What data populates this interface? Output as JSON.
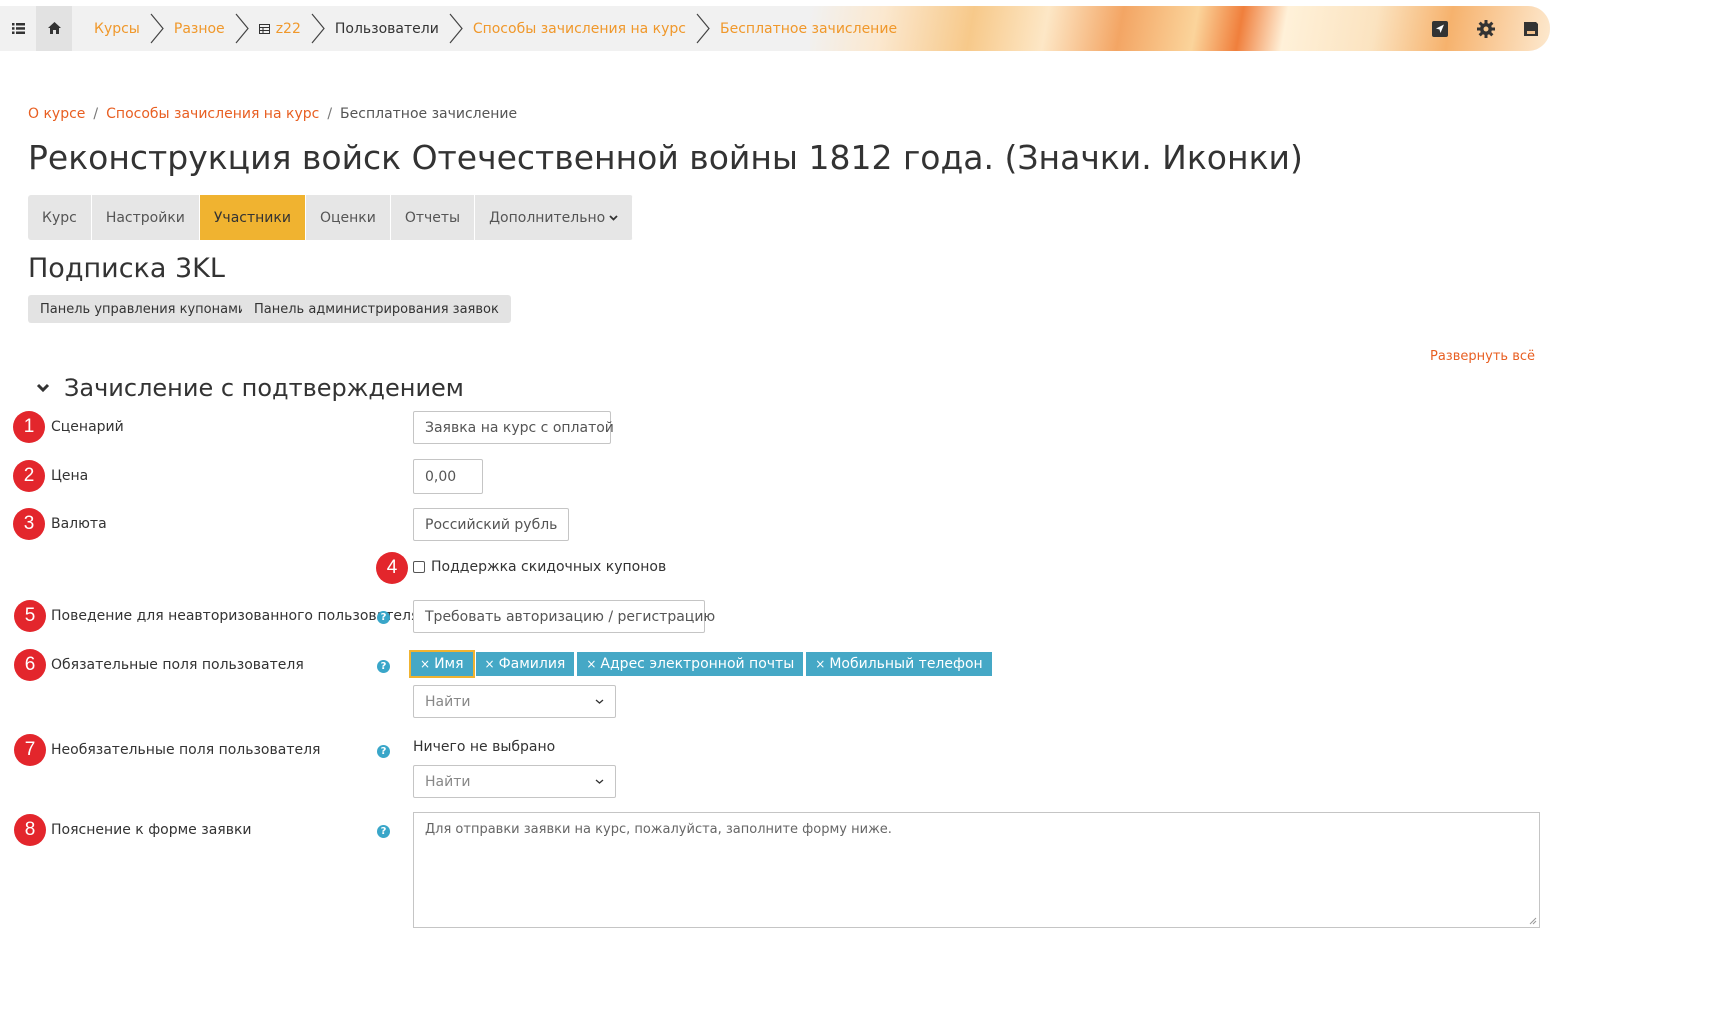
{
  "topbar": {
    "crumbs": [
      "Курсы",
      "Разное",
      "z22",
      "Пользователи",
      "Способы зачисления на курс",
      "Бесплатное зачисление"
    ],
    "right_icons": [
      "send-icon",
      "gear-icon",
      "save-icon"
    ]
  },
  "breadcrumb": {
    "items": [
      "О курсе",
      "Способы зачисления на курс",
      "Бесплатное зачисление"
    ],
    "separator": "/"
  },
  "page": {
    "title": "Реконструкция войск Отечественной войны 1812 года. (Значки. Иконки)",
    "subtitle": "Подписка 3KL"
  },
  "tabs": [
    {
      "label": "Курс",
      "active": false
    },
    {
      "label": "Настройки",
      "active": false
    },
    {
      "label": "Участники",
      "active": true
    },
    {
      "label": "Оценки",
      "active": false
    },
    {
      "label": "Отчеты",
      "active": false
    },
    {
      "label": "Дополнительно",
      "active": false
    }
  ],
  "buttons": {
    "coupons": "Панель управления купонами",
    "requests": "Панель администрирования заявок"
  },
  "expand_all": "Развернуть всё",
  "section": {
    "title": "Зачисление с подтверждением"
  },
  "form": {
    "badges": [
      "1",
      "2",
      "3",
      "4",
      "5",
      "6",
      "7",
      "8"
    ],
    "scenario": {
      "label": "Сценарий",
      "value": "Заявка на курс с оплатой"
    },
    "price": {
      "label": "Цена",
      "value": "0,00"
    },
    "currency": {
      "label": "Валюта",
      "value": "Российский рубль"
    },
    "coupons": {
      "label": "Поддержка скидочных купонов",
      "checked": false
    },
    "behavior": {
      "label": "Поведение для неавторизованного пользователя",
      "value": "Требовать авторизацию / регистрацию"
    },
    "required_fields": {
      "label": "Обязательные поля пользователя",
      "tags": [
        "Имя",
        "Фамилия",
        "Адрес электронной почты",
        "Мобильный телефон"
      ],
      "search_placeholder": "Найти"
    },
    "optional_fields": {
      "label": "Необязательные поля пользователя",
      "none": "Ничего не выбрано",
      "search_placeholder": "Найти"
    },
    "explanation": {
      "label": "Пояснение к форме заявки",
      "value": "Для отправки заявки на курс, пожалуйста, заполните форму ниже."
    }
  },
  "colors": {
    "accent": "#f0b330",
    "link": "#e85f22",
    "tag": "#45a8c6",
    "badge": "#e3262c",
    "help": "#39a6c9"
  }
}
